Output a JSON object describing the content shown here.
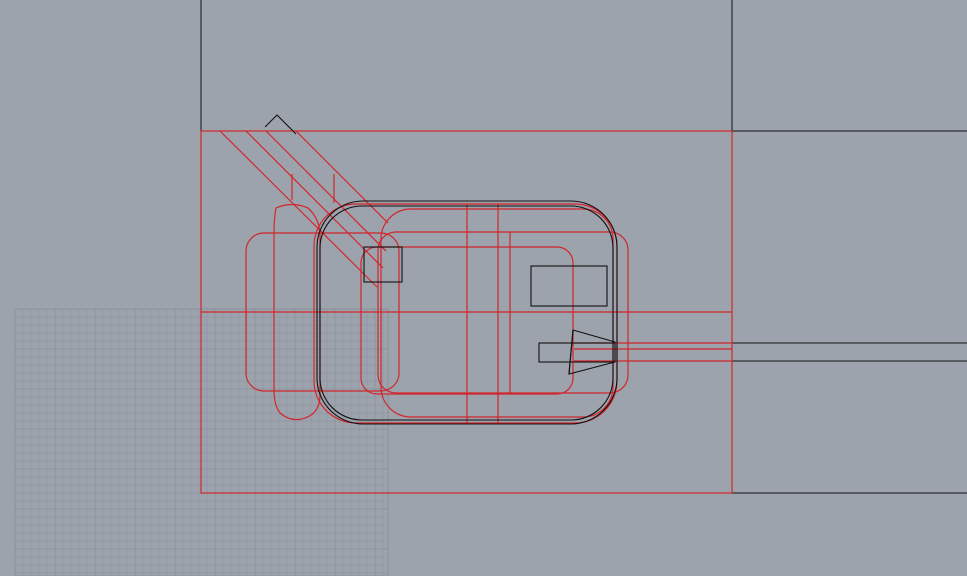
{
  "viewport": {
    "background": "#9da3ad",
    "grid_color": "#8a919b",
    "curve_black": "#111111",
    "curve_red": "#d2262b"
  }
}
